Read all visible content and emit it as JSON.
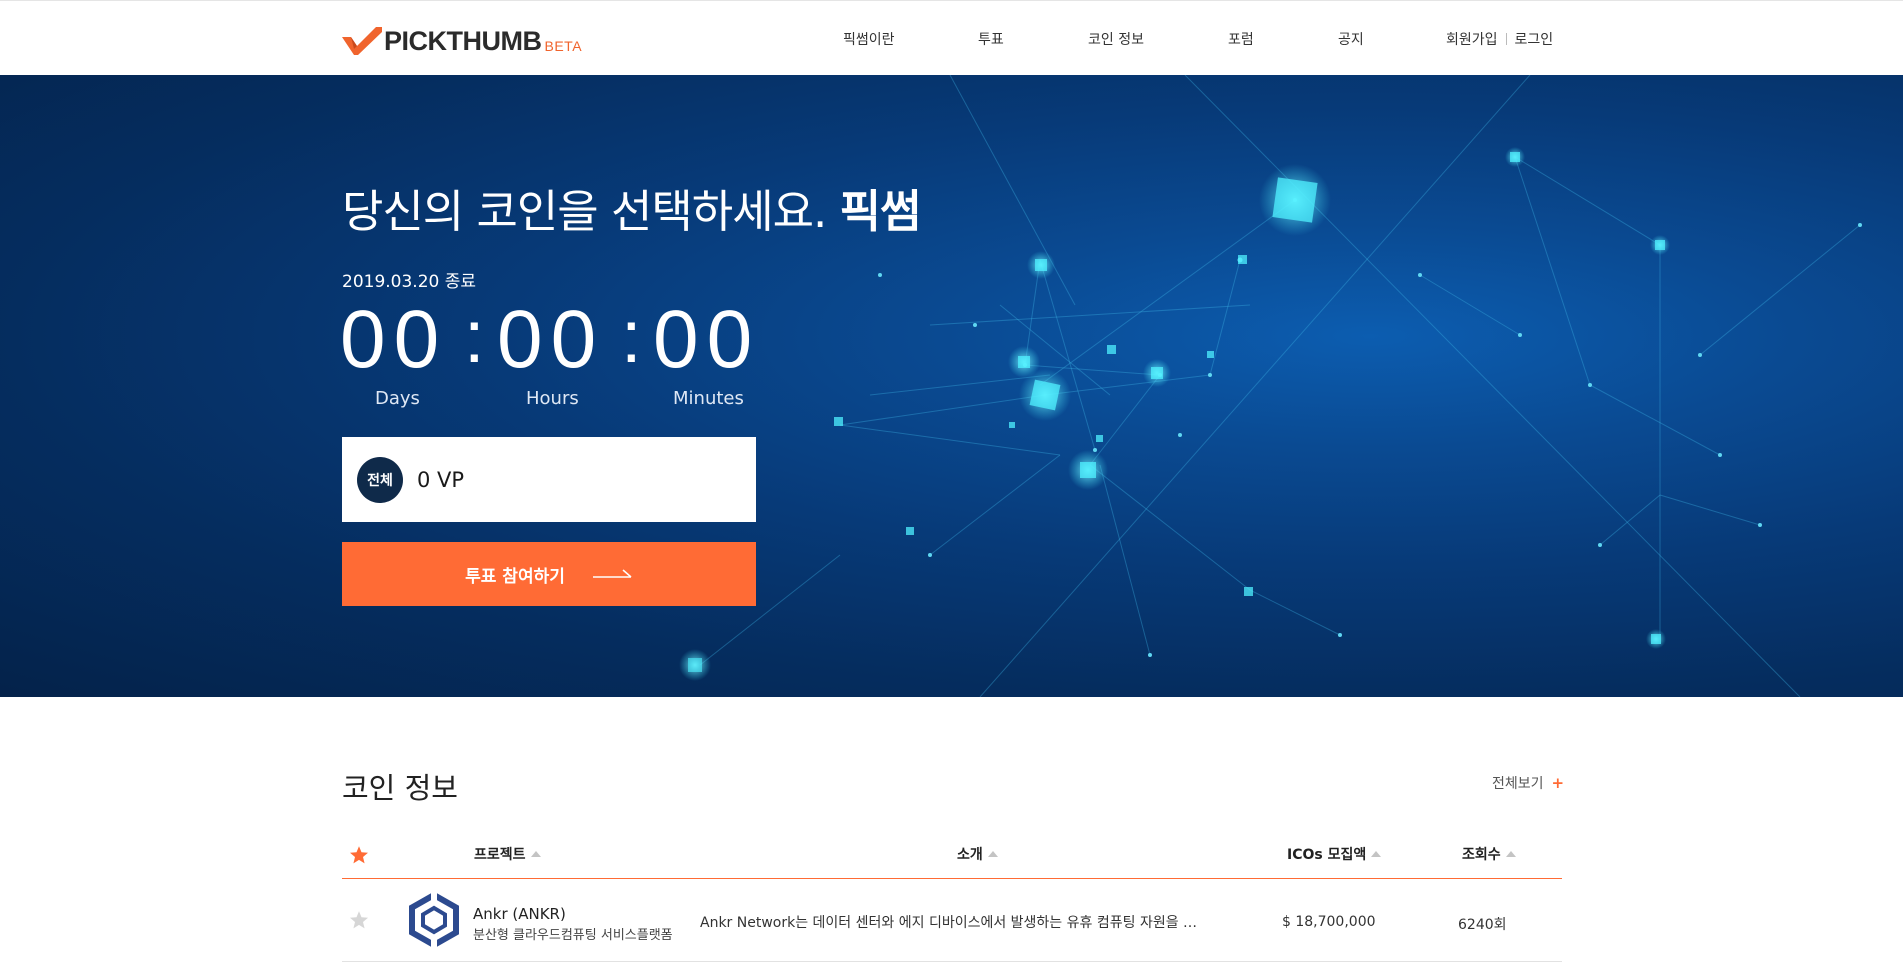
{
  "header": {
    "logo": {
      "text": "PICKTHUMB",
      "badge": "BETA",
      "brand_color": "#f0642d"
    },
    "nav": [
      {
        "label": "픽썸이란"
      },
      {
        "label": "투표"
      },
      {
        "label": "코인 정보"
      },
      {
        "label": "포럼"
      },
      {
        "label": "공지"
      }
    ],
    "auth": {
      "signup": "회원가입",
      "login": "로그인"
    }
  },
  "hero": {
    "title": "당신의 코인을 선택하세요.",
    "title_bold": "픽썸",
    "end_text": "2019.03.20 종료",
    "countdown": {
      "days": "00",
      "hours": "00",
      "minutes": "00",
      "days_label": "Days",
      "hours_label": "Hours",
      "minutes_label": "Minutes"
    },
    "vp": {
      "badge": "전체",
      "value": "0 VP"
    },
    "vote_button": "투표 참여하기",
    "accent_color": "#ff6b35",
    "background_color": "#073a78"
  },
  "coin_info": {
    "title": "코인 정보",
    "view_all": "전체보기",
    "columns": {
      "project": "프로젝트",
      "intro": "소개",
      "ico": "ICOs 모집액",
      "views": "조회수"
    },
    "rows": [
      {
        "name": "Ankr (ANKR)",
        "subtitle": "분산형 클라우드컴퓨팅 서비스플랫폼",
        "intro": "Ankr Network는 데이터 센터와 에지 디바이스에서 발생하는 유휴 컴퓨팅 자원을 …",
        "ico": "$ 18,700,000",
        "views": "6240회",
        "favorited": false
      }
    ]
  }
}
